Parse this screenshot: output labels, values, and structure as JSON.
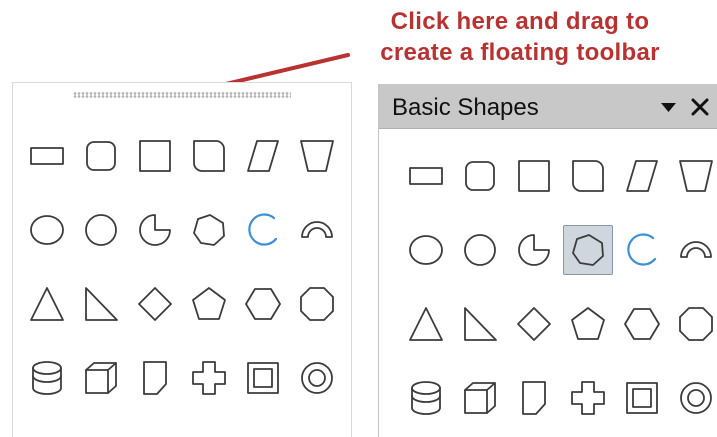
{
  "callout": {
    "lines": [
      "Click here and drag to",
      "create a floating toolbar"
    ],
    "color": "#b83232"
  },
  "docked_toolbar": {
    "grip": "drag-handle",
    "shapes": [
      "rectangle-icon",
      "rounded-rectangle-icon",
      "square-icon",
      "rounded-square-icon",
      "parallelogram-icon",
      "trapezoid-icon",
      "ellipse-icon",
      "circle-icon",
      "circle-pie-icon",
      "block-arc-icon",
      "arc-icon",
      "block-arc-half-icon",
      "isosceles-triangle-icon",
      "right-triangle-icon",
      "diamond-icon",
      "pentagon-icon",
      "hexagon-icon",
      "octagon-icon",
      "cylinder-icon",
      "cube-icon",
      "folded-corner-icon",
      "cross-icon",
      "frame-icon",
      "ring-icon"
    ]
  },
  "floating_toolbar": {
    "title": "Basic Shapes",
    "menu_icon": "dropdown-triangle-icon",
    "close_icon": "close-icon",
    "selected_shape": "block-arc-icon",
    "shapes": [
      "rectangle-icon",
      "rounded-rectangle-icon",
      "square-icon",
      "rounded-square-icon",
      "parallelogram-icon",
      "trapezoid-icon",
      "ellipse-icon",
      "circle-icon",
      "circle-pie-icon",
      "block-arc-icon",
      "arc-icon",
      "block-arc-half-icon",
      "isosceles-triangle-icon",
      "right-triangle-icon",
      "diamond-icon",
      "pentagon-icon",
      "hexagon-icon",
      "octagon-icon",
      "cylinder-icon",
      "cube-icon",
      "folded-corner-icon",
      "cross-icon",
      "frame-icon",
      "ring-icon"
    ]
  },
  "colors": {
    "icon_stroke": "#3c3c3c",
    "arc_accent": "#3d8fd6",
    "title_bar": "#c8c8c8",
    "selected_bg": "#d0d6de"
  }
}
